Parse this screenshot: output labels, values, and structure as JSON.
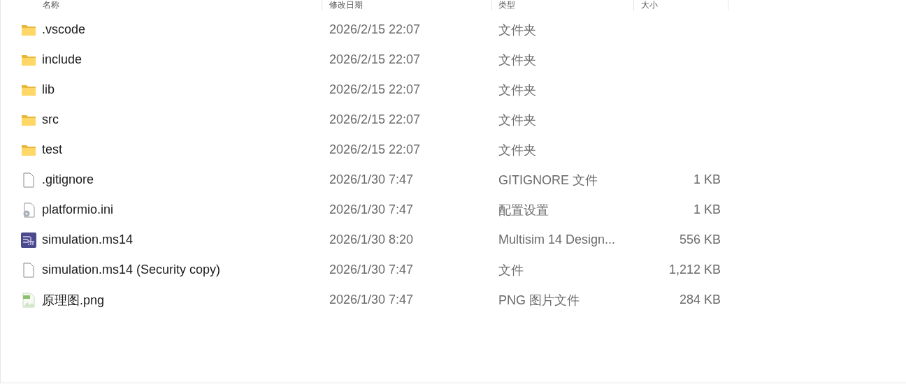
{
  "columns": [
    {
      "label": "名称"
    },
    {
      "label": "修改日期"
    },
    {
      "label": "类型"
    },
    {
      "label": "大小"
    }
  ],
  "rows": [
    {
      "kind": "folder",
      "name": ".vscode",
      "modified": "2026/2/15 22:07",
      "type": "文件夹"
    },
    {
      "kind": "folder",
      "name": "include",
      "modified": "2026/2/15 22:07",
      "type": "文件夹"
    },
    {
      "kind": "folder",
      "name": "lib",
      "modified": "2026/2/15 22:07",
      "type": "文件夹"
    },
    {
      "kind": "folder",
      "name": "src",
      "modified": "2026/2/15 22:07",
      "type": "文件夹"
    },
    {
      "kind": "folder",
      "name": "test",
      "modified": "2026/2/15 22:07",
      "type": "文件夹"
    },
    {
      "kind": "file",
      "name": ".gitignore",
      "modified": "2026/1/30 7:47",
      "type": "GITIGNORE 文件",
      "size": "1 KB"
    },
    {
      "kind": "settings",
      "name": "platformio.ini",
      "modified": "2026/1/30 7:47",
      "type": "配置设置",
      "size": "1 KB"
    },
    {
      "kind": "design",
      "name": "simulation.ms14",
      "modified": "2026/1/30 8:20",
      "type": "Multisim 14 Design...",
      "size": "556 KB"
    },
    {
      "kind": "file",
      "name": "simulation.ms14 (Security copy)",
      "modified": "2026/1/30 7:47",
      "type": "文件",
      "size": "1,212 KB"
    },
    {
      "kind": "image",
      "name": "原理图.png",
      "modified": "2026/1/30 7:47",
      "type": "PNG 图片文件",
      "size": "284 KB"
    }
  ]
}
